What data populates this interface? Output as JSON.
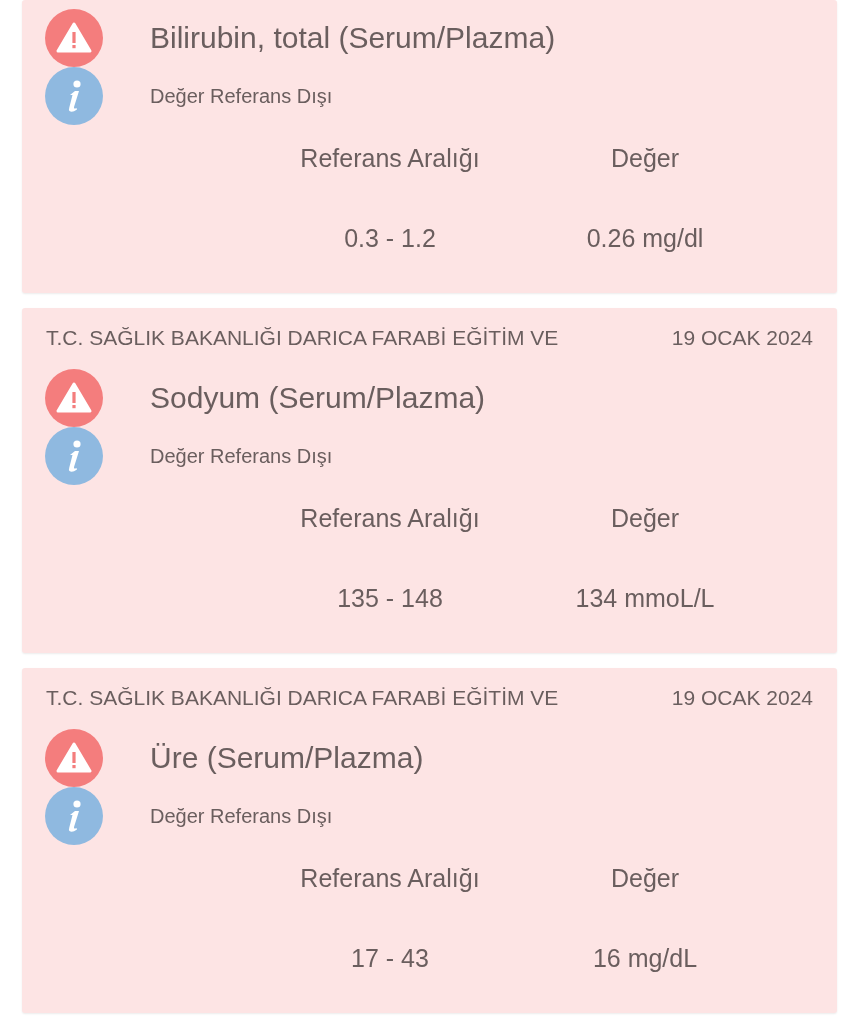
{
  "results": [
    {
      "title": "Bilirubin, total (Serum/Plazma)",
      "status": "Değer Referans Dışı",
      "range_label": "Referans Aralığı",
      "value_label": "Değer",
      "range": "0.3 - 1.2",
      "value": "0.26 mg/dl"
    },
    {
      "institution": "T.C. SAĞLIK BAKANLIĞI DARICA FARABİ EĞİTİM VE",
      "date": "19 OCAK 2024",
      "title": "Sodyum (Serum/Plazma)",
      "status": "Değer Referans Dışı",
      "range_label": "Referans Aralığı",
      "value_label": "Değer",
      "range": "135 - 148",
      "value": "134 mmoL/L"
    },
    {
      "institution": "T.C. SAĞLIK BAKANLIĞI DARICA FARABİ EĞİTİM VE",
      "date": "19 OCAK 2024",
      "title": "Üre (Serum/Plazma)",
      "status": "Değer Referans Dışı",
      "range_label": "Referans Aralığı",
      "value_label": "Değer",
      "range": "17 - 43",
      "value": "16 mg/dL"
    }
  ]
}
